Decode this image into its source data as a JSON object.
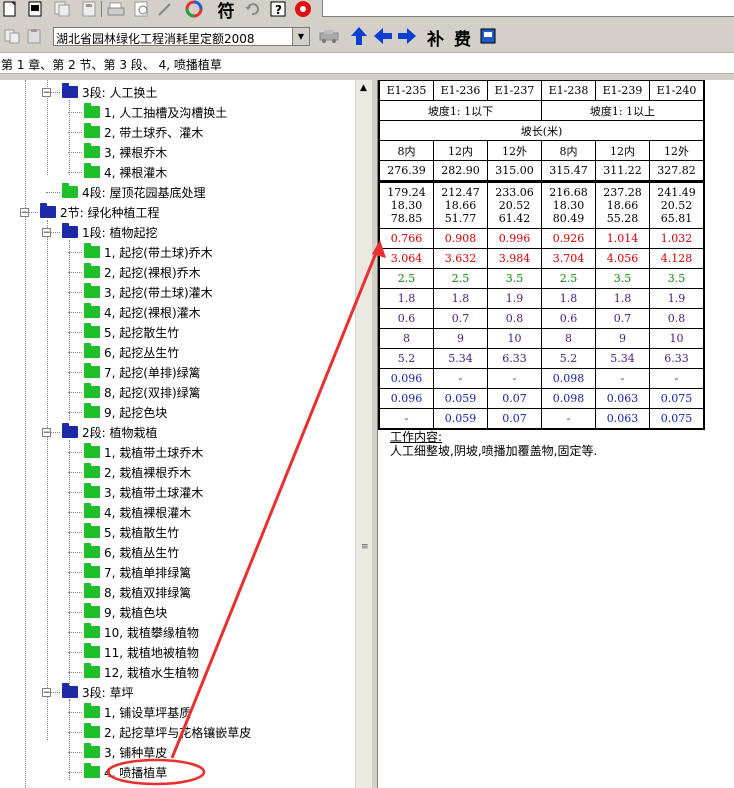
{
  "toolbar_top": {
    "pane_text": "",
    "icons": [
      "new-doc-icon",
      "open-doc-icon",
      "copy-doc-icon",
      "paste-doc-icon",
      "print-icon",
      "preview-icon",
      "edit-icon",
      "color-wheel-icon",
      "help-icon",
      "undo-icon",
      "question-icon",
      "record-icon"
    ],
    "char_button": "符"
  },
  "toolbar_second": {
    "combo_value": "湖北省园林绿化工程消耗里定额2008",
    "char_buttons": [
      "补",
      "费"
    ]
  },
  "breadcrumb": "第 1 章、第 2 节、第 3 段、 4, 喷播植草",
  "tree": [
    {
      "label": "3段: 人工换土",
      "level": 2,
      "type": "folder"
    },
    {
      "label": "1, 人工抽槽及沟槽换土",
      "level": 3,
      "type": "leaf"
    },
    {
      "label": "2, 带土球乔、灌木",
      "level": 3,
      "type": "leaf"
    },
    {
      "label": "3, 裸根乔木",
      "level": 3,
      "type": "leaf"
    },
    {
      "label": "4, 裸根灌木",
      "level": 3,
      "type": "leaf"
    },
    {
      "label": "4段: 屋顶花园基底处理",
      "level": 2,
      "type": "leaf"
    },
    {
      "label": "2节: 绿化种植工程",
      "level": 1,
      "type": "folder"
    },
    {
      "label": "1段: 植物起挖",
      "level": 2,
      "type": "folder"
    },
    {
      "label": "1, 起挖(带土球)乔木",
      "level": 3,
      "type": "leaf"
    },
    {
      "label": "2, 起挖(裸根)乔木",
      "level": 3,
      "type": "leaf"
    },
    {
      "label": "3, 起挖(带土球)灌木",
      "level": 3,
      "type": "leaf"
    },
    {
      "label": "4, 起挖(裸根)灌木",
      "level": 3,
      "type": "leaf"
    },
    {
      "label": "5, 起挖散生竹",
      "level": 3,
      "type": "leaf"
    },
    {
      "label": "6, 起挖丛生竹",
      "level": 3,
      "type": "leaf"
    },
    {
      "label": "7, 起挖(单排)绿篱",
      "level": 3,
      "type": "leaf"
    },
    {
      "label": "8, 起挖(双排)绿篱",
      "level": 3,
      "type": "leaf"
    },
    {
      "label": "9, 起挖色块",
      "level": 3,
      "type": "leaf"
    },
    {
      "label": "2段: 植物栽植",
      "level": 2,
      "type": "folder"
    },
    {
      "label": "1, 栽植带土球乔木",
      "level": 3,
      "type": "leaf"
    },
    {
      "label": "2, 栽植裸根乔木",
      "level": 3,
      "type": "leaf"
    },
    {
      "label": "3, 栽植带土球灌木",
      "level": 3,
      "type": "leaf"
    },
    {
      "label": "4, 栽植裸根灌木",
      "level": 3,
      "type": "leaf"
    },
    {
      "label": "5, 栽植散生竹",
      "level": 3,
      "type": "leaf"
    },
    {
      "label": "6, 栽植丛生竹",
      "level": 3,
      "type": "leaf"
    },
    {
      "label": "7, 栽植单排绿篱",
      "level": 3,
      "type": "leaf"
    },
    {
      "label": "8, 栽植双排绿篱",
      "level": 3,
      "type": "leaf"
    },
    {
      "label": "9, 栽植色块",
      "level": 3,
      "type": "leaf"
    },
    {
      "label": "10, 栽植攀缘植物",
      "level": 3,
      "type": "leaf"
    },
    {
      "label": "11, 栽植地被植物",
      "level": 3,
      "type": "leaf"
    },
    {
      "label": "12, 栽植水生植物",
      "level": 3,
      "type": "leaf"
    },
    {
      "label": "3段: 草坪",
      "level": 2,
      "type": "folder"
    },
    {
      "label": "1, 铺设草坪基质",
      "level": 3,
      "type": "leaf"
    },
    {
      "label": "2, 起挖草坪与花格镶嵌草皮",
      "level": 3,
      "type": "leaf"
    },
    {
      "label": "3, 铺种草皮",
      "level": 3,
      "type": "leaf"
    },
    {
      "label": "4, 喷播植草",
      "level": 3,
      "type": "leaf",
      "selected": true
    }
  ],
  "quota_table": {
    "codes": [
      "E1-235",
      "E1-236",
      "E1-237",
      "E1-238",
      "E1-239",
      "E1-240"
    ],
    "slope_groups": [
      "坡度1: 1以下",
      "坡度1: 1以上"
    ],
    "slope_length_label": "坡长(米)",
    "lengths": [
      "8内",
      "12内",
      "12外",
      "8内",
      "12内",
      "12外"
    ],
    "base_prices": [
      "276.39",
      "282.90",
      "315.00",
      "315.47",
      "311.22",
      "327.82"
    ],
    "cost_breakdown": [
      [
        "179.24",
        "18.30",
        "78.85"
      ],
      [
        "212.47",
        "18.66",
        "51.77"
      ],
      [
        "233.06",
        "20.52",
        "61.42"
      ],
      [
        "216.68",
        "18.30",
        "80.49"
      ],
      [
        "237.28",
        "18.66",
        "55.28"
      ],
      [
        "241.49",
        "20.52",
        "65.81"
      ]
    ],
    "rows": [
      {
        "color": "red",
        "values": [
          "0.766",
          "0.908",
          "0.996",
          "0.926",
          "1.014",
          "1.032"
        ]
      },
      {
        "color": "red",
        "values": [
          "3.064",
          "3.632",
          "3.984",
          "3.704",
          "4.056",
          "4.128"
        ]
      },
      {
        "color": "green",
        "values": [
          "2.5",
          "2.5",
          "3.5",
          "2.5",
          "3.5",
          "3.5"
        ]
      },
      {
        "color": "purple",
        "values": [
          "1.8",
          "1.8",
          "1.9",
          "1.8",
          "1.8",
          "1.9"
        ]
      },
      {
        "color": "purple",
        "values": [
          "0.6",
          "0.7",
          "0.8",
          "0.6",
          "0.7",
          "0.8"
        ]
      },
      {
        "color": "purple",
        "values": [
          "8",
          "9",
          "10",
          "8",
          "9",
          "10"
        ]
      },
      {
        "color": "purple",
        "values": [
          "5.2",
          "5.34",
          "6.33",
          "5.2",
          "5.34",
          "6.33"
        ]
      },
      {
        "color": "blue",
        "values": [
          "0.096",
          "-",
          "-",
          "0.098",
          "-",
          "-"
        ]
      },
      {
        "color": "blue",
        "values": [
          "0.096",
          "0.059",
          "0.07",
          "0.098",
          "0.063",
          "0.075"
        ]
      },
      {
        "color": "blue",
        "values": [
          "-",
          "0.059",
          "0.07",
          "-",
          "0.063",
          "0.075"
        ]
      }
    ]
  },
  "work_content": {
    "title": "工作内容:",
    "body": "人工细整坡,阴坡,喷播加覆盖物,固定等."
  }
}
